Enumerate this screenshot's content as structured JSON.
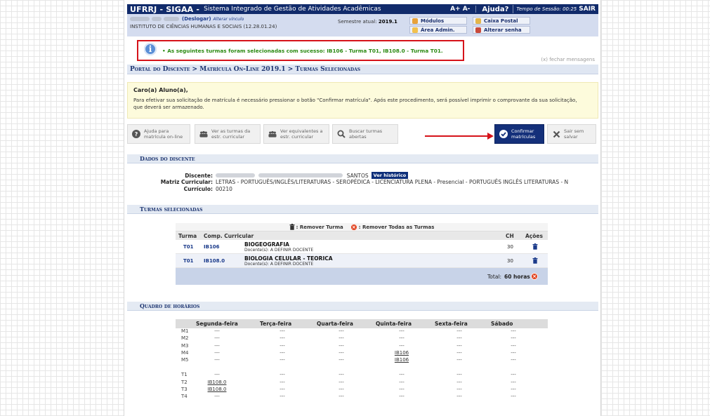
{
  "topbar": {
    "brand": "UFRRJ - SIGAA -",
    "system": "Sistema Integrado de Gestão de Atividades Acadêmicas",
    "font_size": "A+ A-",
    "help": "Ajuda?",
    "session": "Tempo de Sessão: 00:25",
    "exit": "SAIR"
  },
  "infobar": {
    "logout": "(Deslogar)",
    "change_link": "Alterar vínculo",
    "institute": "INSTITUTO DE CIÊNCIAS HUMANAS E SOCIAIS (12.28.01.24)",
    "semester_label": "Semestre atual:",
    "semester_value": "2019.1",
    "modules": "Módulos",
    "mailbox": "Caixa Postal",
    "admin_area": "Área Admin.",
    "change_password": "Alterar senha"
  },
  "message": {
    "text": "• As seguintes turmas foram selecionadas com sucesso: IB106 - Turma T01, IB108.0 - Turma T01.",
    "close": "(x) fechar mensagens"
  },
  "breadcrumb": "Portal do Discente > Matrícula On-Line 2019.1 > Turmas Selecionadas",
  "notice": {
    "greeting": "Caro(a) Aluno(a),",
    "text": "Para efetivar sua solicitação de matrícula é necessário pressionar o botão \"Confirmar matrícula\". Após este procedimento, será possível imprimir o comprovante da sua solicitação, que deverá ser armazenado."
  },
  "actions": {
    "help": [
      "Ajuda para",
      "matrícula on-line"
    ],
    "view_classes": [
      "Ver as turmas da",
      "estr. curricular"
    ],
    "view_equivalents": [
      "Ver equivalentes a",
      "estr. curricular"
    ],
    "search_classes": [
      "Buscar turmas",
      "abertas"
    ],
    "confirm": [
      "Confirmar",
      "matrículas"
    ],
    "exit_no_save": [
      "Sair sem",
      "salvar"
    ]
  },
  "dados": {
    "title": "Dados do discente",
    "discente_label": "Discente:",
    "discente_suffix": "SANTOS",
    "history_button": "Ver histórico",
    "matriz_label": "Matriz Curricular:",
    "matriz_value": "LETRAS - PORTUGUÊS/INGLÊS/LITERATURAS - SEROPÉDICA - LICENCIATURA PLENA - Presencial - PORTUGUÊS INGLÊS LITERATURAS - N",
    "curriculo_label": "Currículo:",
    "curriculo_value": "00210"
  },
  "turmas": {
    "title": "Turmas selecionadas",
    "legend_remove": ": Remover Turma",
    "legend_remove_all": ": Remover Todas as Turmas",
    "headers": {
      "turma": "Turma",
      "comp": "Comp. Curricular",
      "ch": "CH",
      "acoes": "Ações"
    },
    "rows": [
      {
        "turma": "T01",
        "code": "IB106",
        "name": "BIOGEOGRAFIA",
        "docente": "Docente(s): A DEFINIR DOCENTE",
        "ch": "30"
      },
      {
        "turma": "T01",
        "code": "IB108.0",
        "name": "BIOLOGIA CELULAR - TEORICA",
        "docente": "Docente(s): A DEFINIR DOCENTE",
        "ch": "30"
      }
    ],
    "total_label": "Total:",
    "total_value": "60 horas"
  },
  "horarios": {
    "title": "Quadro de horários",
    "days": [
      "Segunda-feira",
      "Terça-feira",
      "Quarta-feira",
      "Quinta-feira",
      "Sexta-feira",
      "Sábado"
    ],
    "rows": [
      {
        "slot": "M1",
        "cells": [
          "---",
          "---",
          "---",
          "---",
          "---",
          "---"
        ]
      },
      {
        "slot": "M2",
        "cells": [
          "---",
          "---",
          "---",
          "---",
          "---",
          "---"
        ]
      },
      {
        "slot": "M3",
        "cells": [
          "---",
          "---",
          "---",
          "---",
          "---",
          "---"
        ]
      },
      {
        "slot": "M4",
        "cells": [
          "---",
          "---",
          "---",
          "IB106",
          "---",
          "---"
        ]
      },
      {
        "slot": "M5",
        "cells": [
          "---",
          "---",
          "---",
          "IB106",
          "---",
          "---"
        ]
      },
      {
        "slot": "T1",
        "cells": [
          "---",
          "---",
          "---",
          "---",
          "---",
          "---"
        ]
      },
      {
        "slot": "T2",
        "cells": [
          "IB108.0",
          "---",
          "---",
          "---",
          "---",
          "---"
        ]
      },
      {
        "slot": "T3",
        "cells": [
          "IB108.0",
          "---",
          "---",
          "---",
          "---",
          "---"
        ]
      },
      {
        "slot": "T4",
        "cells": [
          "---",
          "---",
          "---",
          "---",
          "---",
          "---"
        ]
      }
    ]
  }
}
